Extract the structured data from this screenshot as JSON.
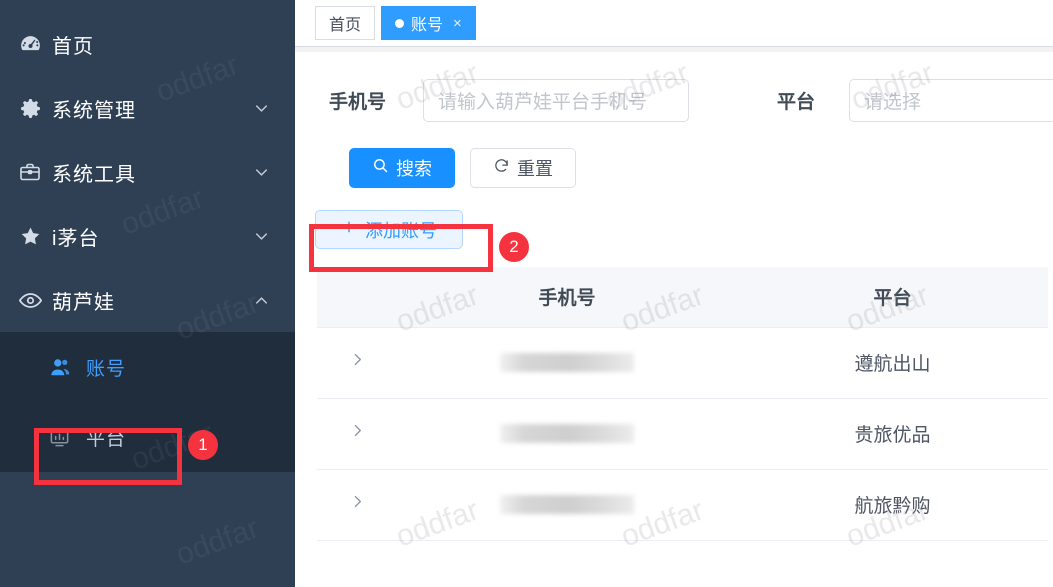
{
  "sidebar": {
    "menu": [
      {
        "label": "首页",
        "icon": "dashboard-icon",
        "arrow": "none"
      },
      {
        "label": "系统管理",
        "icon": "gear-icon",
        "arrow": "down"
      },
      {
        "label": "系统工具",
        "icon": "briefcase-icon",
        "arrow": "down"
      },
      {
        "label": "i茅台",
        "icon": "star-icon",
        "arrow": "down"
      },
      {
        "label": "葫芦娃",
        "icon": "eye-icon",
        "arrow": "up"
      }
    ],
    "submenu": [
      {
        "label": "账号",
        "icon": "user-icon",
        "active": true
      },
      {
        "label": "平台",
        "icon": "chart-icon",
        "active": false
      }
    ]
  },
  "tabs": [
    {
      "label": "首页",
      "active": false,
      "closable": false
    },
    {
      "label": "账号",
      "active": true,
      "closable": true,
      "close_label": "×"
    }
  ],
  "search_form": {
    "phone": {
      "label": "手机号",
      "value": "",
      "placeholder": "请输入葫芦娃平台手机号"
    },
    "platform": {
      "label": "平台",
      "value": "",
      "placeholder": "请选择"
    },
    "search_button": "搜索",
    "search_icon": "search-icon",
    "reset_button": "重置",
    "reset_icon": "refresh-icon"
  },
  "toolbar": {
    "add_label": "添加账号",
    "add_icon": "plus-icon"
  },
  "table": {
    "columns": [
      "",
      "手机号",
      "平台"
    ],
    "rows": [
      {
        "expand_icon": "chevron-right-icon",
        "phone": "",
        "phone_redacted": true,
        "platform": "遵航出山"
      },
      {
        "expand_icon": "chevron-right-icon",
        "phone": "",
        "phone_redacted": true,
        "platform": "贵旅优品"
      },
      {
        "expand_icon": "chevron-right-icon",
        "phone": "",
        "phone_redacted": true,
        "platform": "航旅黔购"
      }
    ]
  },
  "annotations": [
    {
      "id": "1",
      "target": "sidebar-item-account"
    },
    {
      "id": "2",
      "target": "add-account-button"
    }
  ],
  "watermark": {
    "text": "oddfar"
  },
  "colors": {
    "sidebar_bg": "#2f3f54",
    "submenu_bg": "#1f2d3d",
    "accent": "#1890ff",
    "tab_active": "#2e9dff",
    "annotation_red": "#f5333f",
    "table_header_bg": "#f5f7fa"
  }
}
